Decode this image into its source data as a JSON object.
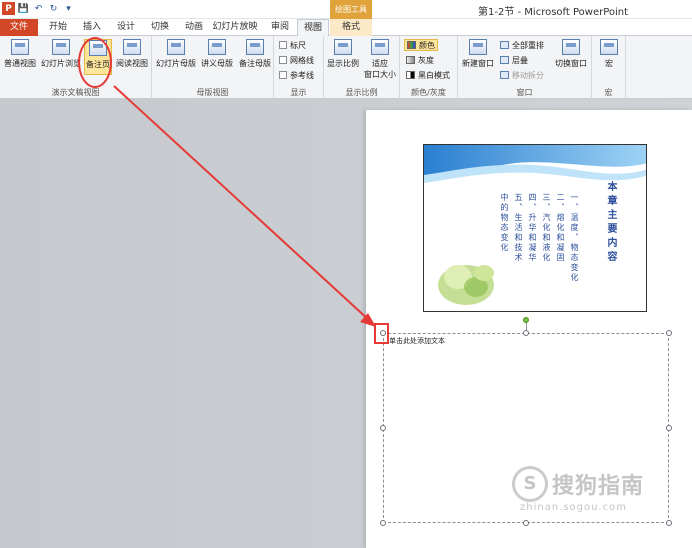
{
  "titlebar": {
    "doc_title": "第1-2节 - Microsoft PowerPoint",
    "context_label": "绘图工具",
    "qat": [
      "P",
      "💾",
      "↶",
      "↻",
      "▾"
    ]
  },
  "tabs": {
    "file": "文件",
    "home": "开始",
    "insert": "插入",
    "design": "设计",
    "transitions": "切换",
    "animations": "动画",
    "slideshow": "幻灯片放映",
    "review": "审阅",
    "view": "视图",
    "format": "格式"
  },
  "ribbon": {
    "presentation_views": {
      "label": "演示文稿视图",
      "normal": "普通视图",
      "slide_sorter": "幻灯片浏览",
      "notes_page": "备注页",
      "reading": "阅读视图"
    },
    "master_views": {
      "label": "母版视图",
      "slide_master": "幻灯片母版",
      "handout_master": "讲义母版",
      "notes_master": "备注母版"
    },
    "show": {
      "label": "显示",
      "ruler": "标尺",
      "gridlines": "网格线",
      "guides": "参考线"
    },
    "zoom": {
      "label": "显示比例",
      "zoom": "显示比例",
      "fit_line1": "适应",
      "fit_line2": "窗口大小"
    },
    "color": {
      "label": "颜色/灰度",
      "color": "颜色",
      "grayscale": "灰度",
      "bw": "黑白模式"
    },
    "window": {
      "label": "窗口",
      "new_window": "新建窗口",
      "arrange_all": "全部重排",
      "cascade": "层叠",
      "move_split": "移动拆分",
      "switch_windows": "切换窗口"
    },
    "macros": {
      "label": "宏",
      "macros": "宏"
    }
  },
  "slide": {
    "title": "本章主要内容",
    "lines": [
      "一、温度、物态变化",
      "二、熔化和凝固",
      "三、汽化和液化",
      "四、升华和凝华",
      "五、生活和技术",
      "中的物态变化"
    ]
  },
  "notes": {
    "placeholder": "单击此处添加文本"
  },
  "watermark": {
    "logo": "S",
    "brand": "搜狗指南",
    "domain": "zhinan.sogou.com"
  }
}
